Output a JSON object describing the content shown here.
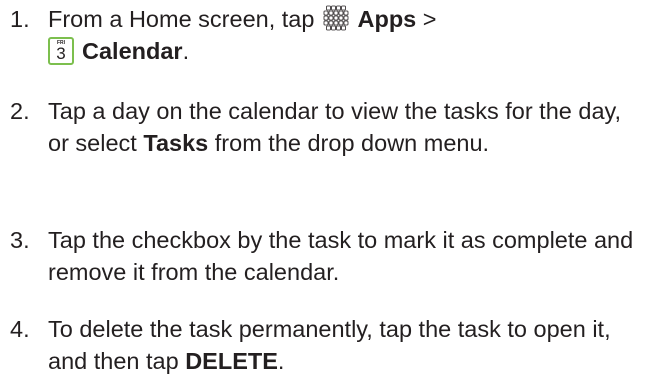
{
  "steps": [
    {
      "number": "1.",
      "line1_prefix": "From a Home screen, tap ",
      "apps_label": "Apps",
      "line1_suffix": " >",
      "calendar_label": "Calendar",
      "line2_suffix": ".",
      "calendar_icon": {
        "day_abbr": "FRI",
        "day_number": "3",
        "border_color": "#7cbf4e"
      },
      "apps_icon": "apps-grid-icon"
    },
    {
      "number": "2.",
      "text_prefix": "Tap a day on the calendar to view the tasks for the day, or select ",
      "bold": "Tasks",
      "text_suffix": " from the drop down menu."
    },
    {
      "number": "3.",
      "text": "Tap the checkbox by the task to mark it as complete and remove it from the calendar."
    },
    {
      "number": "4.",
      "text_prefix": "To delete the task permanently, tap the task to open it, and then tap ",
      "bold": "DELETE",
      "text_suffix": "."
    }
  ]
}
